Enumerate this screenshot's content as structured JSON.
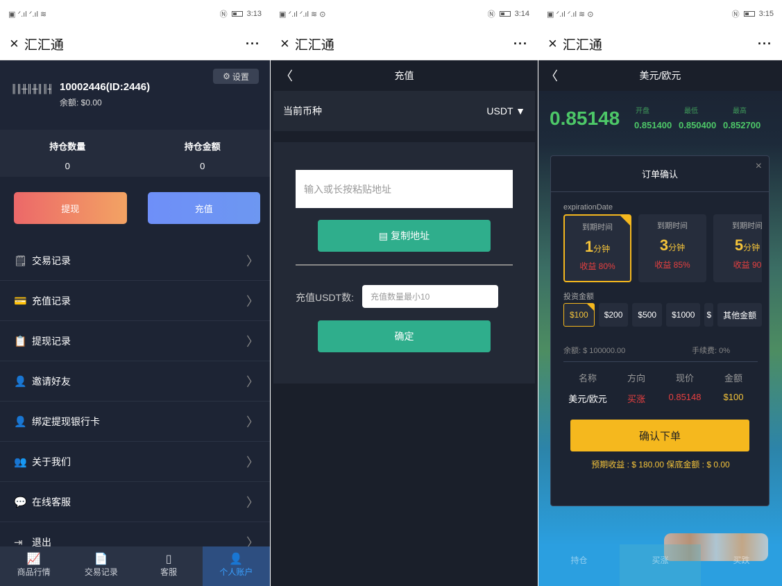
{
  "status": [
    {
      "time": "3:13"
    },
    {
      "time": "3:14"
    },
    {
      "time": "3:15"
    }
  ],
  "wechat": {
    "title": "汇汇通",
    "close": "×",
    "more": "···"
  },
  "account": {
    "user_id": "10002446(ID:2446)",
    "balance": "余额: $0.00",
    "settings": "设置",
    "stats": [
      {
        "label": "持仓数量",
        "value": "0"
      },
      {
        "label": "持仓金额",
        "value": "0"
      }
    ],
    "withdraw": "提现",
    "deposit": "充值",
    "menu": [
      {
        "icon": "doc-icon",
        "glyph": "🗒",
        "label": "交易记录"
      },
      {
        "icon": "wallet-icon",
        "glyph": "💳",
        "label": "充值记录"
      },
      {
        "icon": "calendar-icon",
        "glyph": "📋",
        "label": "提现记录"
      },
      {
        "icon": "user-plus-icon",
        "glyph": "👤",
        "label": "邀请好友"
      },
      {
        "icon": "user-card-icon",
        "glyph": "👤",
        "label": "绑定提现银行卡"
      },
      {
        "icon": "users-icon",
        "glyph": "👥",
        "label": "关于我们"
      },
      {
        "icon": "chat-icon",
        "glyph": "💬",
        "label": "在线客服"
      },
      {
        "icon": "logout-icon",
        "glyph": "⇥",
        "label": "退出"
      }
    ],
    "tabs": [
      {
        "label": "商品行情",
        "icon": "market-icon",
        "glyph": "📈"
      },
      {
        "label": "交易记录",
        "icon": "records-icon",
        "glyph": "📄"
      },
      {
        "label": "客服",
        "icon": "service-icon",
        "glyph": "▯"
      },
      {
        "label": "个人账户",
        "icon": "account-icon",
        "glyph": "👤"
      }
    ]
  },
  "recharge": {
    "title": "充值",
    "currency_label": "当前币种",
    "currency_value": "USDT ▼",
    "address_placeholder": "输入或长按粘贴地址",
    "copy_button": "复制地址",
    "amount_label": "充值USDT数:",
    "amount_placeholder": "充值数量最小10",
    "confirm": "确定"
  },
  "trade": {
    "pair": "美元/欧元",
    "price": "0.85148",
    "ohl_headers": [
      "开盘",
      "最低",
      "最高"
    ],
    "ohl_values": [
      "0.851400",
      "0.850400",
      "0.852700"
    ],
    "modal_title": "订单确认",
    "expiration_label": "expirationDate",
    "expiration_cards": [
      {
        "label": "到期时间",
        "minutes": "1",
        "unit": "分钟",
        "yield": "收益 80%",
        "selected": true
      },
      {
        "label": "到期时间",
        "minutes": "3",
        "unit": "分钟",
        "yield": "收益 85%",
        "selected": false
      },
      {
        "label": "到期时间",
        "minutes": "5",
        "unit": "分钟",
        "yield": "收益 90",
        "selected": false
      }
    ],
    "invest_label": "投资金额",
    "amounts": [
      "$100",
      "$200",
      "$500",
      "$1000",
      "$",
      "其他金额"
    ],
    "balance": "余额: $ 100000.00",
    "fee": "手续费: 0%",
    "table_headers": [
      "名称",
      "方向",
      "现价",
      "金额"
    ],
    "table_row": {
      "name": "美元/欧元",
      "direction": "买涨",
      "price": "0.85148",
      "amount": "$100"
    },
    "confirm_button": "确认下单",
    "expected": "预期收益 : $ 180.00  保底金额 : $ 0.00",
    "tabs": [
      "持仓",
      "买涨",
      "买跌"
    ],
    "colors": {
      "up": "#4dc868",
      "gold": "#f5b81e",
      "red": "#e84040"
    }
  }
}
